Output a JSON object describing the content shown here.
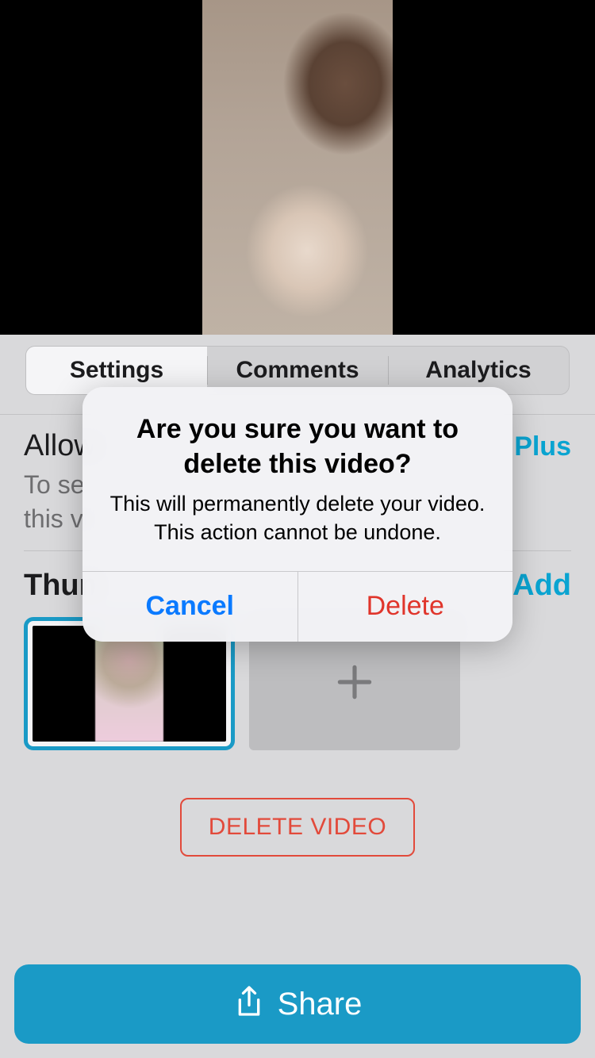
{
  "tabs": {
    "settings": "Settings",
    "comments": "Comments",
    "analytics": "Analytics"
  },
  "allow": {
    "title": "Allow",
    "plus_label": "Plus",
    "subtitle_visible": "To se\nthis vi"
  },
  "thumbnails": {
    "heading_visible": "Thun",
    "add_label": "Add"
  },
  "icons": {
    "plus": "plus-icon",
    "share": "share-icon"
  },
  "delete_video_button": "DELETE VIDEO",
  "share": {
    "label": "Share"
  },
  "alert": {
    "title": "Are you sure you want to delete this video?",
    "message": "This will permanently delete your video.\nThis action cannot be undone.",
    "cancel": "Cancel",
    "delete": "Delete"
  }
}
